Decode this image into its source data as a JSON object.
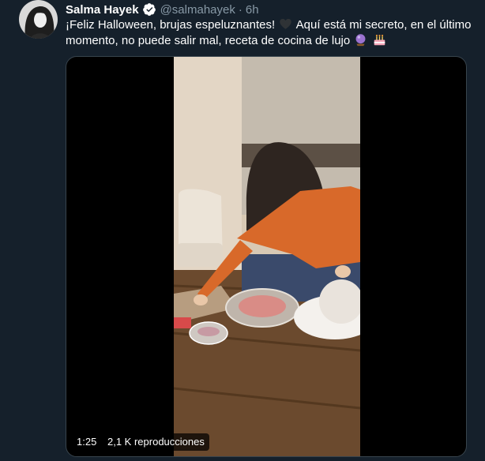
{
  "tweet": {
    "author_name": "Salma Hayek",
    "handle": "@salmahayek",
    "separator": "·",
    "time": "6h",
    "text_part1": "¡Feliz Halloween, brujas espeluznantes!",
    "text_part2": "Aquí está mi secreto, en el último momento, no puede salir mal, receta de cocina de lujo",
    "emojis": [
      "black-heart",
      "crystal-ball",
      "birthday-cake"
    ]
  },
  "video": {
    "duration": "1:25",
    "views": "2,1 K reproducciones"
  },
  "colors": {
    "background": "#15202b",
    "secondary_text": "#8899a6",
    "verified_blue": "#1da1f2",
    "border": "#38444d"
  }
}
